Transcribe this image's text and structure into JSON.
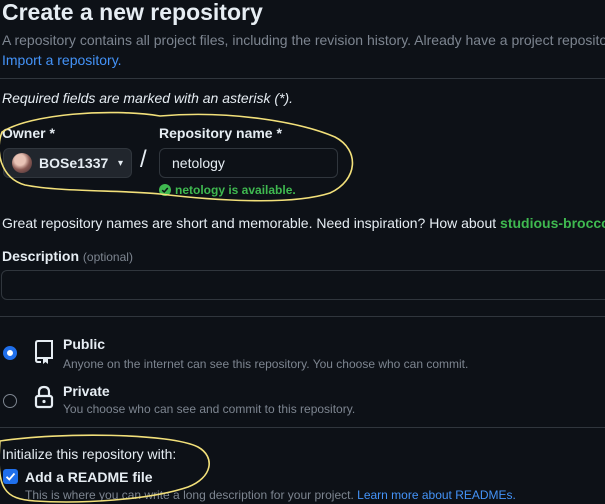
{
  "page": {
    "title": "Create a new repository",
    "subtitle": "A repository contains all project files, including the revision history. Already have a project repository",
    "import_link": "Import a repository.",
    "required_note": "Required fields are marked with an asterisk (*)."
  },
  "owner": {
    "label": "Owner *",
    "value": "BOSe1337"
  },
  "repo_name": {
    "label": "Repository name *",
    "value": "netology",
    "availability": "netology is available."
  },
  "name_hint": {
    "text": "Great repository names are short and memorable. Need inspiration? How about ",
    "suggestion": "studious-broccoli",
    "tail": " ?"
  },
  "description": {
    "label": "Description",
    "optional": "(optional)",
    "value": ""
  },
  "visibility": {
    "selected": "Public",
    "options": [
      {
        "title": "Public",
        "desc": "Anyone on the internet can see this repository. You choose who can commit.",
        "icon": "repo-icon"
      },
      {
        "title": "Private",
        "desc": "You choose who can see and commit to this repository.",
        "icon": "lock-icon"
      }
    ]
  },
  "initialize": {
    "heading": "Initialize this repository with:",
    "readme_label": "Add a README file",
    "readme_checked": true,
    "readme_desc": "This is where you can write a long description for your project. ",
    "readme_link": "Learn more about READMEs."
  },
  "colors": {
    "background": "#0d1117",
    "accent": "#1f6feb",
    "success": "#3fb950",
    "annotation": "#f2e07a"
  }
}
